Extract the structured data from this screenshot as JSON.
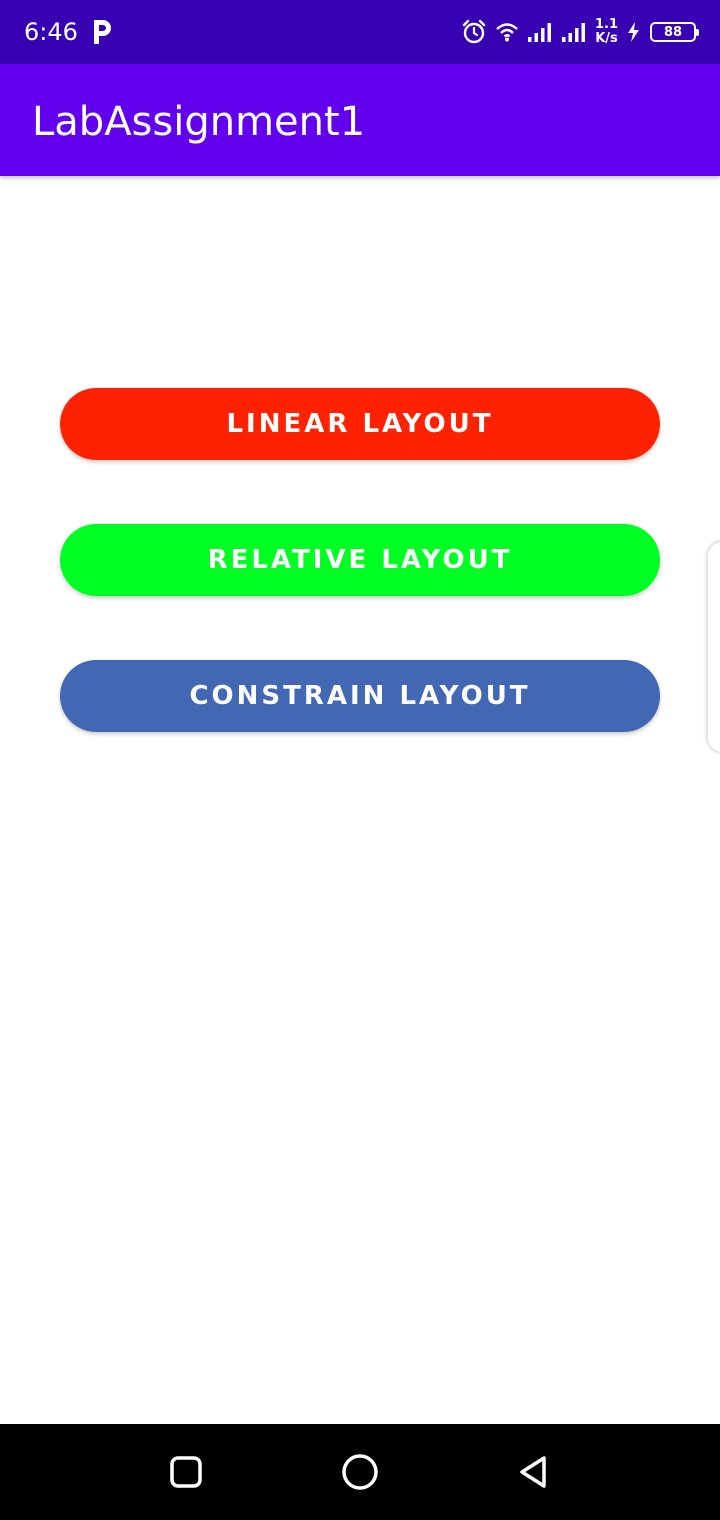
{
  "status_bar": {
    "time": "6:46",
    "app_icon": "p-icon",
    "icons": [
      "alarm-icon",
      "wifi-icon",
      "signal-icon",
      "signal-icon"
    ],
    "speed_value": "1.1",
    "speed_unit": "K/s",
    "battery_level": "88",
    "background_color": "#3700b3"
  },
  "app_bar": {
    "title": "LabAssignment1",
    "background_color": "#6200ee"
  },
  "buttons": {
    "linear": {
      "label": "LINEAR LAYOUT",
      "color": "#ff2200"
    },
    "relative": {
      "label": "RELATIVE LAYOUT",
      "color": "#00ff22"
    },
    "constrain": {
      "label": "CONSTRAIN LAYOUT",
      "color": "#4268b4"
    }
  },
  "nav_bar": {
    "icons": [
      "recents-icon",
      "home-icon",
      "back-icon"
    ]
  }
}
